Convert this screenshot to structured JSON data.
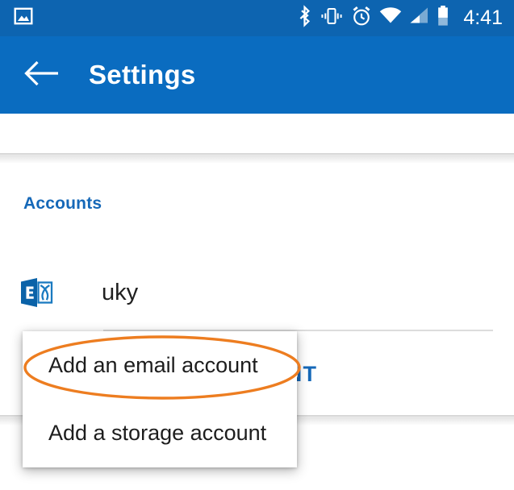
{
  "status_bar": {
    "background_color": "#0d64b0",
    "clock": "4:41",
    "icons": [
      {
        "name": "image-notification-icon",
        "position": "left"
      },
      {
        "name": "bluetooth-icon",
        "position": "right"
      },
      {
        "name": "vibrate-icon",
        "position": "right"
      },
      {
        "name": "alarm-icon",
        "position": "right"
      },
      {
        "name": "wifi-icon",
        "position": "right"
      },
      {
        "name": "cellular-signal-icon",
        "position": "right"
      },
      {
        "name": "battery-icon",
        "position": "right"
      }
    ]
  },
  "app_bar": {
    "background_color": "#0a6cc0",
    "title": "Settings",
    "back_icon": "back-arrow-icon"
  },
  "content": {
    "section_heading": "Accounts",
    "section_heading_color": "#1568b8",
    "accounts": [
      {
        "icon": "exchange-icon",
        "name": "uky"
      }
    ],
    "add_account_action": "ADD ACCOUNT"
  },
  "popup_menu": {
    "items": [
      {
        "label": "Add an email account"
      },
      {
        "label": "Add a storage account"
      }
    ]
  },
  "annotation": {
    "shape": "ellipse",
    "color": "#ED7D20",
    "target": "Add an email account"
  }
}
